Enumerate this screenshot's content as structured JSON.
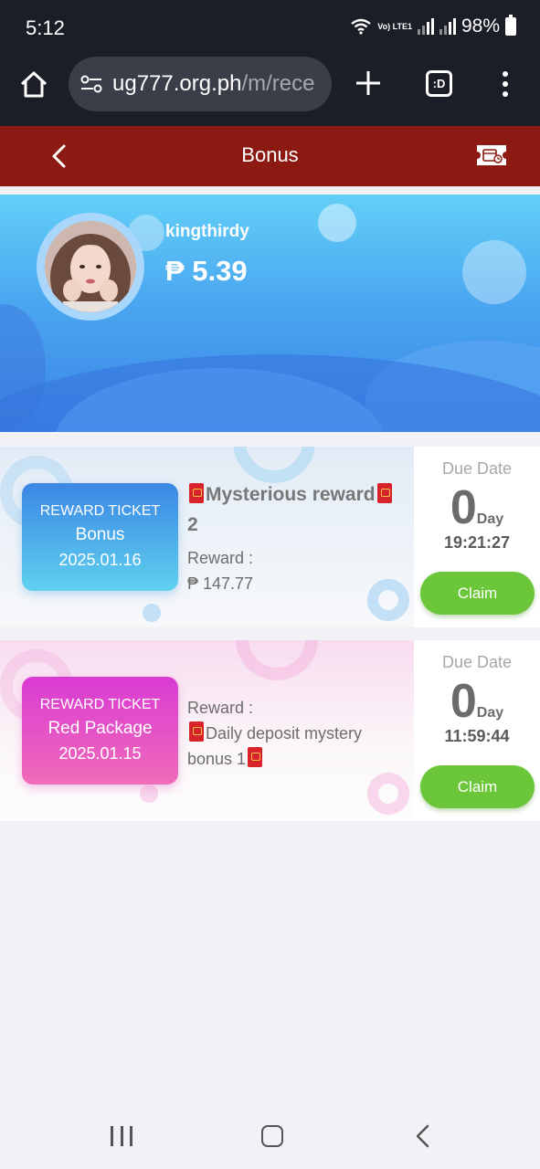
{
  "status_bar": {
    "time": "5:12",
    "network": "Vo) LTE1",
    "battery": "98%"
  },
  "browser": {
    "url_host": "ug777.org.ph",
    "url_path": "/m/rece",
    "tab_label": ":D"
  },
  "header": {
    "title": "Bonus"
  },
  "profile": {
    "username": "kingthirdy",
    "balance": "₱ 5.39"
  },
  "rewards": [
    {
      "ticket_label": "REWARD TICKET",
      "ticket_type": "Bonus",
      "ticket_date": "2025.01.16",
      "title_text": "Mysterious reward",
      "title_suffix": "2",
      "reward_label": "Reward :",
      "reward_amount": "₱ 147.77",
      "due_label": "Due Date",
      "due_days": "0",
      "due_unit": "Day",
      "due_time": "19:21:27",
      "claim_label": "Claim"
    },
    {
      "ticket_label": "REWARD TICKET",
      "ticket_type": "Red Package",
      "ticket_date": "2025.01.15",
      "reward_label": "Reward :",
      "desc_line1": "Daily deposit mystery",
      "desc_line2": "bonus 1",
      "due_label": "Due Date",
      "due_days": "0",
      "due_unit": "Day",
      "due_time": "11:59:44",
      "claim_label": "Claim"
    }
  ],
  "colors": {
    "header_bg": "#8c1a12",
    "claim_green": "#6cc63a",
    "bonus_ticket": "#3b87e5",
    "red_package_ticket": "#d93ad4"
  },
  "icons": [
    "home-icon",
    "tune-icon",
    "plus-icon",
    "more-icon",
    "back-arrow-icon",
    "ticket-icon",
    "red-envelope-icon",
    "nav-recents-icon",
    "nav-home-icon",
    "nav-back-icon"
  ]
}
